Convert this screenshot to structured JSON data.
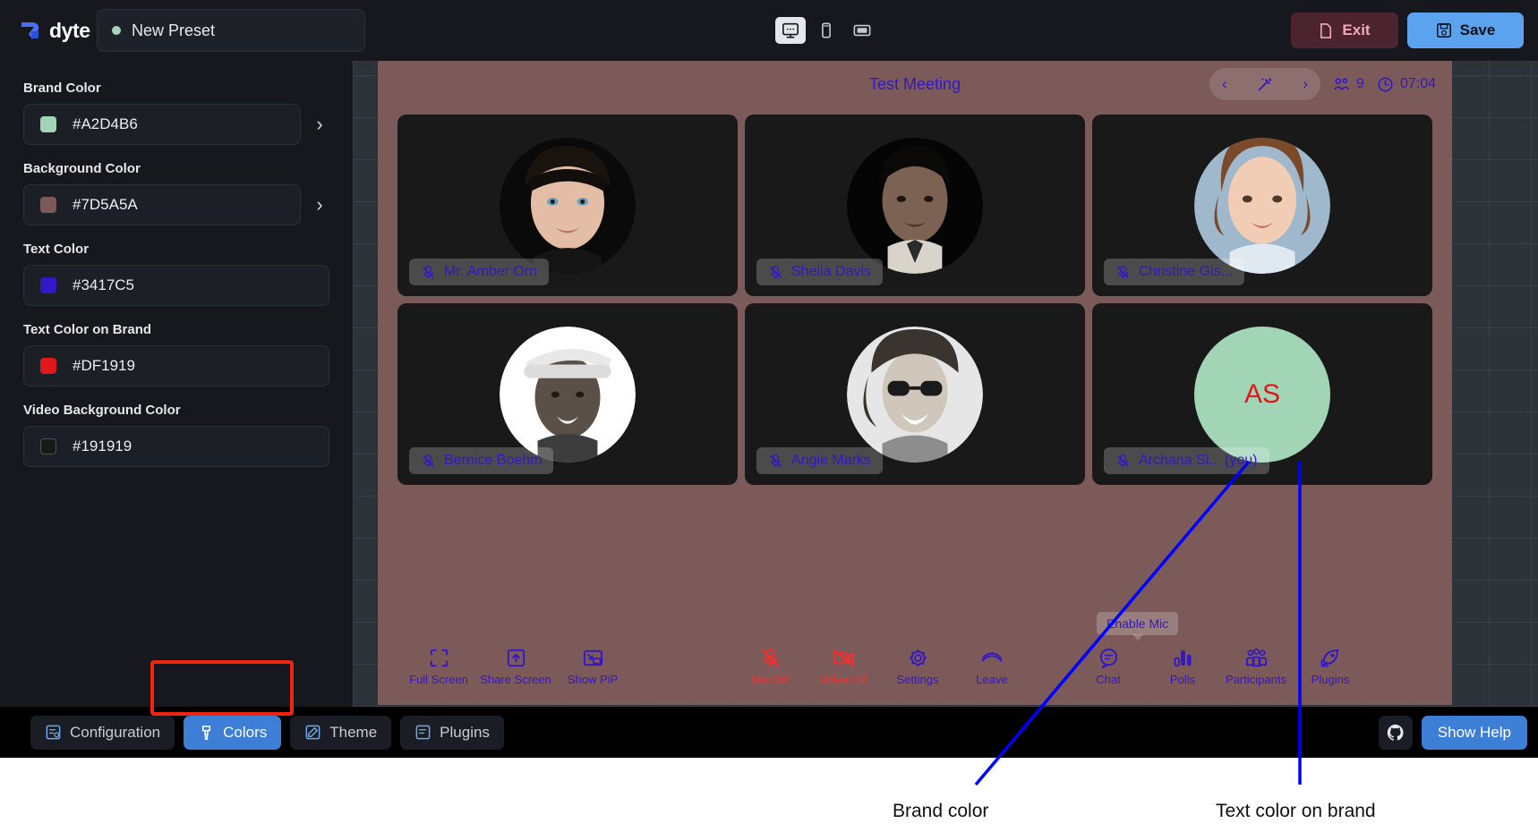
{
  "topbar": {
    "logo_text": "dyte",
    "preset_name": "New Preset",
    "preset_dot_color": "#a2d4b6",
    "devices": [
      {
        "name": "desktop",
        "icon": "monitor-icon",
        "active": true
      },
      {
        "name": "mobile",
        "icon": "phone-icon",
        "active": false
      },
      {
        "name": "tablet",
        "icon": "tablet-landscape-icon",
        "active": false
      }
    ],
    "exit_label": "Exit",
    "save_label": "Save"
  },
  "sidebar": {
    "fields": [
      {
        "label": "Brand Color",
        "value": "#A2D4B6",
        "swatch": "#A2D4B6",
        "has_chevron": true,
        "outline": false
      },
      {
        "label": "Background Color",
        "value": "#7D5A5A",
        "swatch": "#7D5A5A",
        "has_chevron": true,
        "outline": false
      },
      {
        "label": "Text Color",
        "value": "#3417C5",
        "swatch": "#3417C5",
        "has_chevron": false,
        "outline": false
      },
      {
        "label": "Text Color on Brand",
        "value": "#DF1919",
        "swatch": "#DF1919",
        "has_chevron": false,
        "outline": false
      },
      {
        "label": "Video Background Color",
        "value": "#191919",
        "swatch": "#191919",
        "has_chevron": false,
        "outline": true
      }
    ]
  },
  "meeting": {
    "title": "Test Meeting",
    "participant_count": "9",
    "timer": "07:04",
    "background_color": "#7D5A5A",
    "tile_color": "#191919",
    "text_color": "#3417C5",
    "tooltip": "Enable Mic",
    "participants": [
      {
        "name": "Mr. Amber Orn",
        "muted": true,
        "avatar": "photo"
      },
      {
        "name": "Sheila Davis",
        "muted": true,
        "avatar": "photo"
      },
      {
        "name": "Christine Gis...",
        "muted": true,
        "avatar": "photo"
      },
      {
        "name": "Bernice Boehm",
        "muted": true,
        "avatar": "photo"
      },
      {
        "name": "Angie Marks",
        "muted": true,
        "avatar": "photo"
      },
      {
        "name": "Archana Si... (you)",
        "muted": true,
        "avatar": "initials",
        "initials": "AS"
      }
    ],
    "controls": [
      {
        "label": "Full Screen",
        "icon": "fullscreen-icon",
        "danger": false
      },
      {
        "label": "Share Screen",
        "icon": "share-screen-icon",
        "danger": false
      },
      {
        "label": "Show PiP",
        "icon": "pip-icon",
        "danger": false
      },
      {
        "label": "Mic Off",
        "icon": "mic-off-icon",
        "danger": true
      },
      {
        "label": "Video Off",
        "icon": "video-off-icon",
        "danger": true
      },
      {
        "label": "Settings",
        "icon": "gear-icon",
        "danger": false
      },
      {
        "label": "Leave",
        "icon": "leave-call-icon",
        "danger": false
      },
      {
        "label": "Chat",
        "icon": "chat-icon",
        "danger": false
      },
      {
        "label": "Polls",
        "icon": "polls-icon",
        "danger": false
      },
      {
        "label": "Participants",
        "icon": "participants-icon",
        "danger": false
      },
      {
        "label": "Plugins",
        "icon": "plugins-icon",
        "danger": false
      }
    ]
  },
  "bottom": {
    "tabs": [
      {
        "label": "Configuration",
        "icon": "configuration-icon",
        "active": false
      },
      {
        "label": "Colors",
        "icon": "palette-icon",
        "active": true
      },
      {
        "label": "Theme",
        "icon": "theme-icon",
        "active": false
      },
      {
        "label": "Plugins",
        "icon": "plugins-tab-icon",
        "active": false
      }
    ],
    "help_label": "Show Help",
    "github_icon": "github-icon"
  },
  "annotations": [
    {
      "label": "Brand color",
      "color": "#0000ff"
    },
    {
      "label": "Text color on brand",
      "color": "#0000ff"
    }
  ]
}
